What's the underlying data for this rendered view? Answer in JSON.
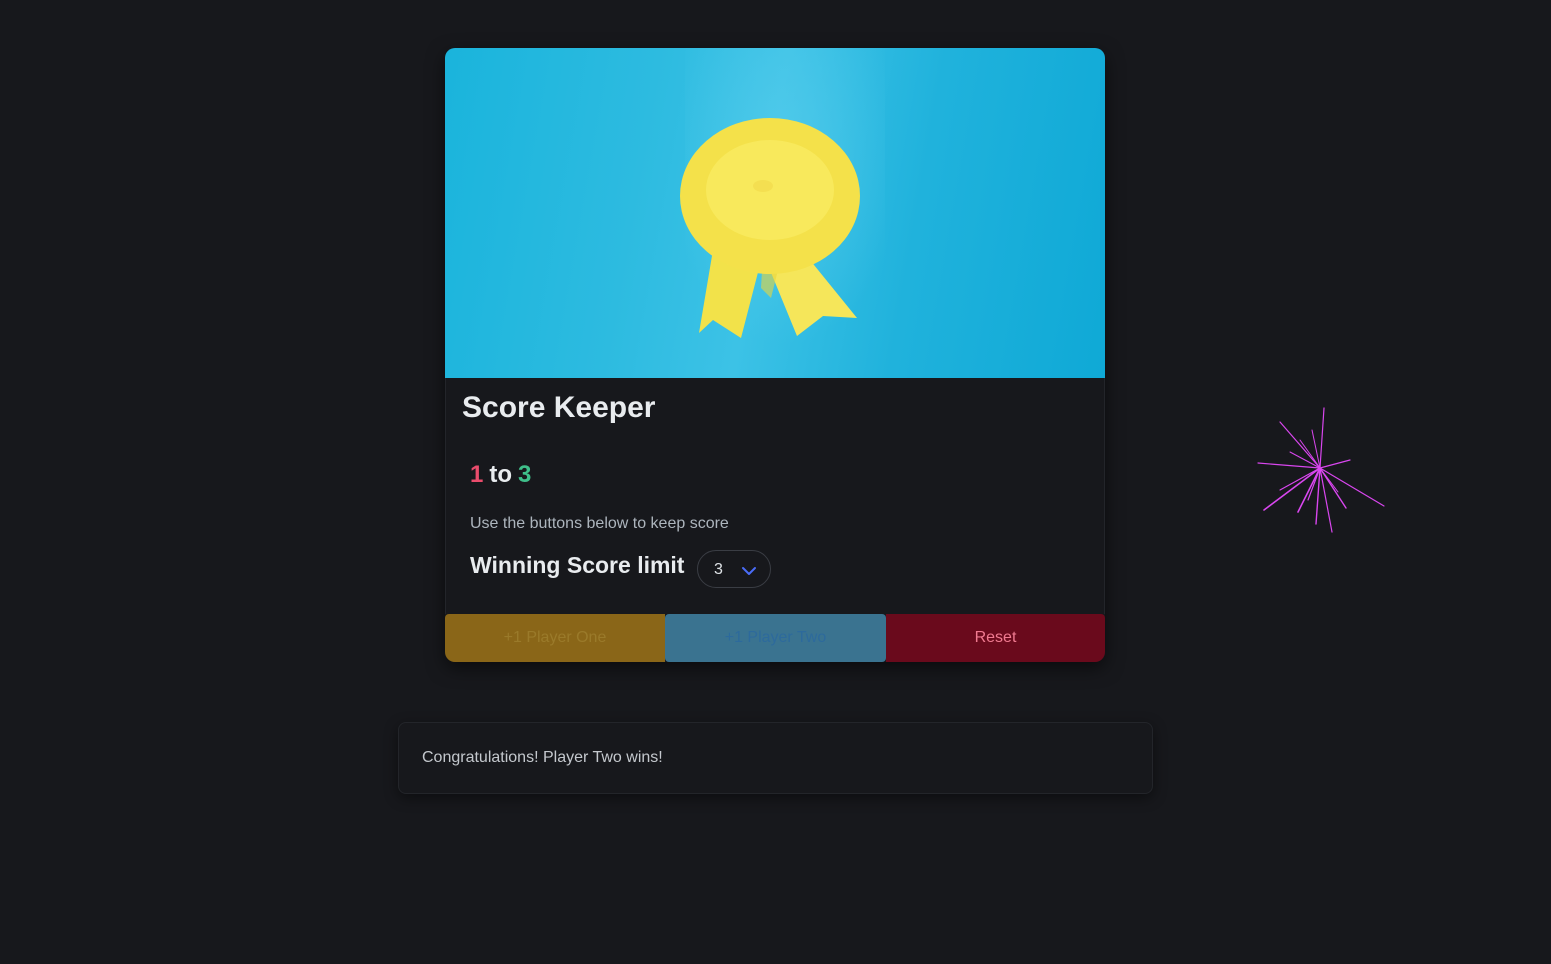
{
  "card": {
    "image": "award-ribbon-image",
    "title": "Score Keeper",
    "score": {
      "player_one": "1",
      "separator": "to",
      "player_two": "3"
    },
    "help_text": "Use the buttons below to keep score",
    "limit_label": "Winning Score limit",
    "limit_select": {
      "selected": "3",
      "icon": "chevron-down-icon"
    },
    "buttons": {
      "player_one": "+1 Player One",
      "player_two": "+1 Player Two",
      "reset": "Reset"
    }
  },
  "message": "Congratulations! Player Two wins!",
  "colors": {
    "background": "#17181c",
    "player_one_score": "#ea4c6c",
    "player_two_score": "#3fbf8a",
    "player_one_button": "#8a6618",
    "player_two_button": "#3a7390",
    "reset_button": "#6a0a1c",
    "firework": "#d946ef"
  },
  "decoration": {
    "firework": "firework-burst"
  }
}
